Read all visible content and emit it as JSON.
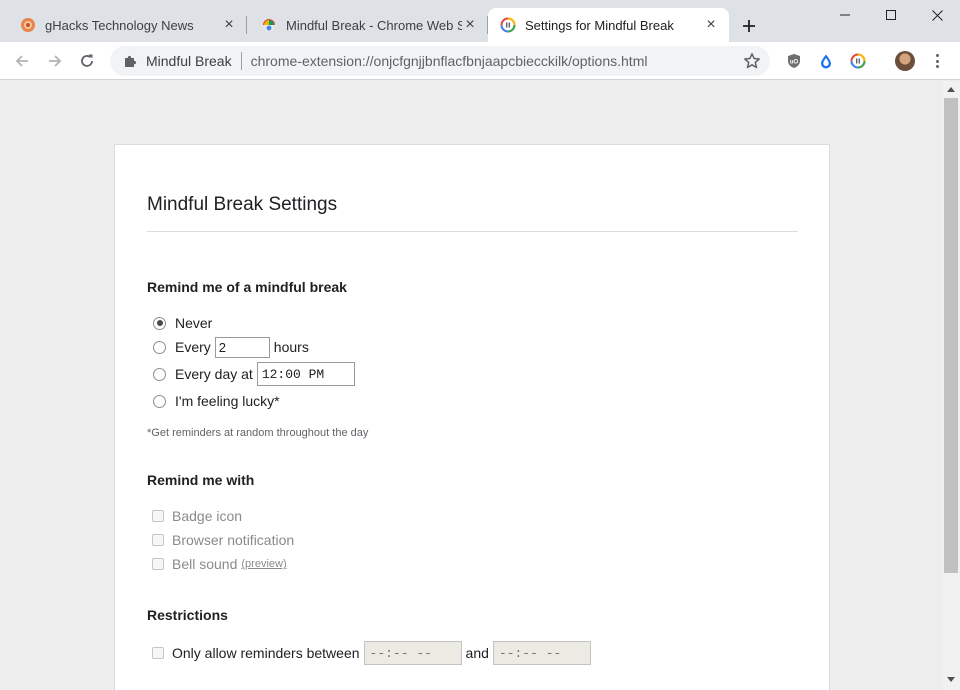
{
  "browser": {
    "tabs": [
      {
        "title": "gHacks Technology News",
        "favicon": "ghacks-icon",
        "active": false
      },
      {
        "title": "Mindful Break - Chrome Web Store",
        "favicon": "chrome-web-store-icon",
        "active": false
      },
      {
        "title": "Settings for Mindful Break",
        "favicon": "mindful-break-icon",
        "active": true
      }
    ],
    "omnibox": {
      "site_name": "Mindful Break",
      "url": "chrome-extension://onjcfgnjjbnflacfbnjaapcbiecckilk/options.html"
    },
    "extensions": [
      "ublock-icon",
      "drop-icon",
      "mindful-break-icon"
    ]
  },
  "settings": {
    "title": "Mindful Break Settings",
    "remind_section": {
      "heading": "Remind me of a mindful break",
      "options": {
        "never": "Never",
        "every_prefix": "Every",
        "every_value": "2",
        "every_suffix": "hours",
        "every_day": "Every day at",
        "every_day_time": "12:00 PM",
        "lucky": "I'm feeling lucky*"
      },
      "selected": "never",
      "footnote": "*Get reminders at random throughout the day"
    },
    "remind_with": {
      "heading": "Remind me with",
      "badge": "Badge icon",
      "notification": "Browser notification",
      "bell": "Bell sound",
      "preview": "(preview)"
    },
    "restrictions": {
      "heading": "Restrictions",
      "only_allow": "Only allow reminders between",
      "from_placeholder": "--:-- --",
      "and": "and",
      "to_placeholder": "--:-- --"
    }
  }
}
